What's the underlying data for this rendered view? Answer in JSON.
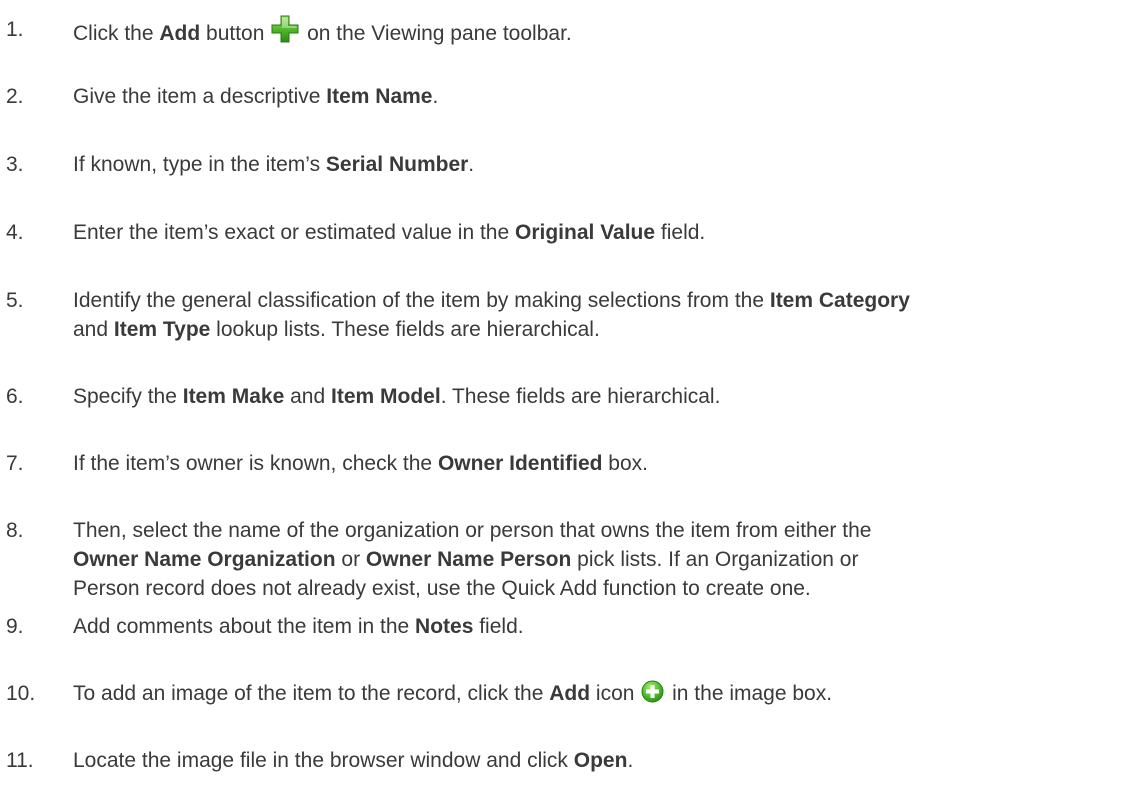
{
  "steps": [
    {
      "number": "1.",
      "lines": [
        [
          {
            "t": "Click the "
          },
          {
            "t": "Add",
            "b": true
          },
          {
            "t": " button "
          },
          {
            "icon": "green-plus-icon"
          },
          {
            "t": " on the Viewing pane toolbar."
          }
        ]
      ]
    },
    {
      "number": "2.",
      "lines": [
        [
          {
            "t": "Give the item a descriptive "
          },
          {
            "t": "Item Name",
            "b": true
          },
          {
            "t": "."
          }
        ]
      ]
    },
    {
      "number": "3.",
      "lines": [
        [
          {
            "t": "If known, type in the item’s "
          },
          {
            "t": "Serial Number",
            "b": true
          },
          {
            "t": "."
          }
        ]
      ]
    },
    {
      "number": "4.",
      "lines": [
        [
          {
            "t": "Enter the item’s exact or estimated value in the "
          },
          {
            "t": "Original Value",
            "b": true
          },
          {
            "t": " field."
          }
        ]
      ]
    },
    {
      "number": "5.",
      "lines": [
        [
          {
            "t": "Identify the general classification of the item by making selections from the "
          },
          {
            "t": "Item Category",
            "b": true
          }
        ],
        [
          {
            "t": "and "
          },
          {
            "t": "Item Type",
            "b": true
          },
          {
            "t": " lookup lists. These fields are hierarchical."
          }
        ]
      ]
    },
    {
      "number": "6.",
      "lines": [
        [
          {
            "t": "Specify the "
          },
          {
            "t": "Item Make",
            "b": true
          },
          {
            "t": " and "
          },
          {
            "t": "Item Model",
            "b": true
          },
          {
            "t": ". These fields are hierarchical."
          }
        ]
      ]
    },
    {
      "number": "7.",
      "lines": [
        [
          {
            "t": "If the item’s owner is known, check the "
          },
          {
            "t": "Owner Identified",
            "b": true
          },
          {
            "t": " box."
          }
        ]
      ]
    },
    {
      "number": "8.",
      "lines": [
        [
          {
            "t": "Then, select the name of the organization or person that owns the item from either the"
          }
        ],
        [
          {
            "t": "Owner Name Organization",
            "b": true
          },
          {
            "t": " or "
          },
          {
            "t": "Owner Name Person",
            "b": true
          },
          {
            "t": " pick lists. If an Organization or"
          }
        ],
        [
          {
            "t": "Person record does not already exist, use the Quick Add function to create one."
          }
        ]
      ]
    },
    {
      "number": "9.",
      "lines": [
        [
          {
            "t": "Add comments about the item in the "
          },
          {
            "t": "Notes",
            "b": true
          },
          {
            "t": " field."
          }
        ]
      ]
    },
    {
      "number": "10.",
      "lines": [
        [
          {
            "t": "To add an image of the item to the record, click the "
          },
          {
            "t": "Add",
            "b": true
          },
          {
            "t": " icon "
          },
          {
            "icon": "green-circle-plus-icon"
          },
          {
            "t": " in the image box."
          }
        ]
      ]
    },
    {
      "number": "11.",
      "lines": [
        [
          {
            "t": "Locate the image file in the browser window and click "
          },
          {
            "t": "Open",
            "b": true
          },
          {
            "t": "."
          }
        ]
      ]
    }
  ]
}
